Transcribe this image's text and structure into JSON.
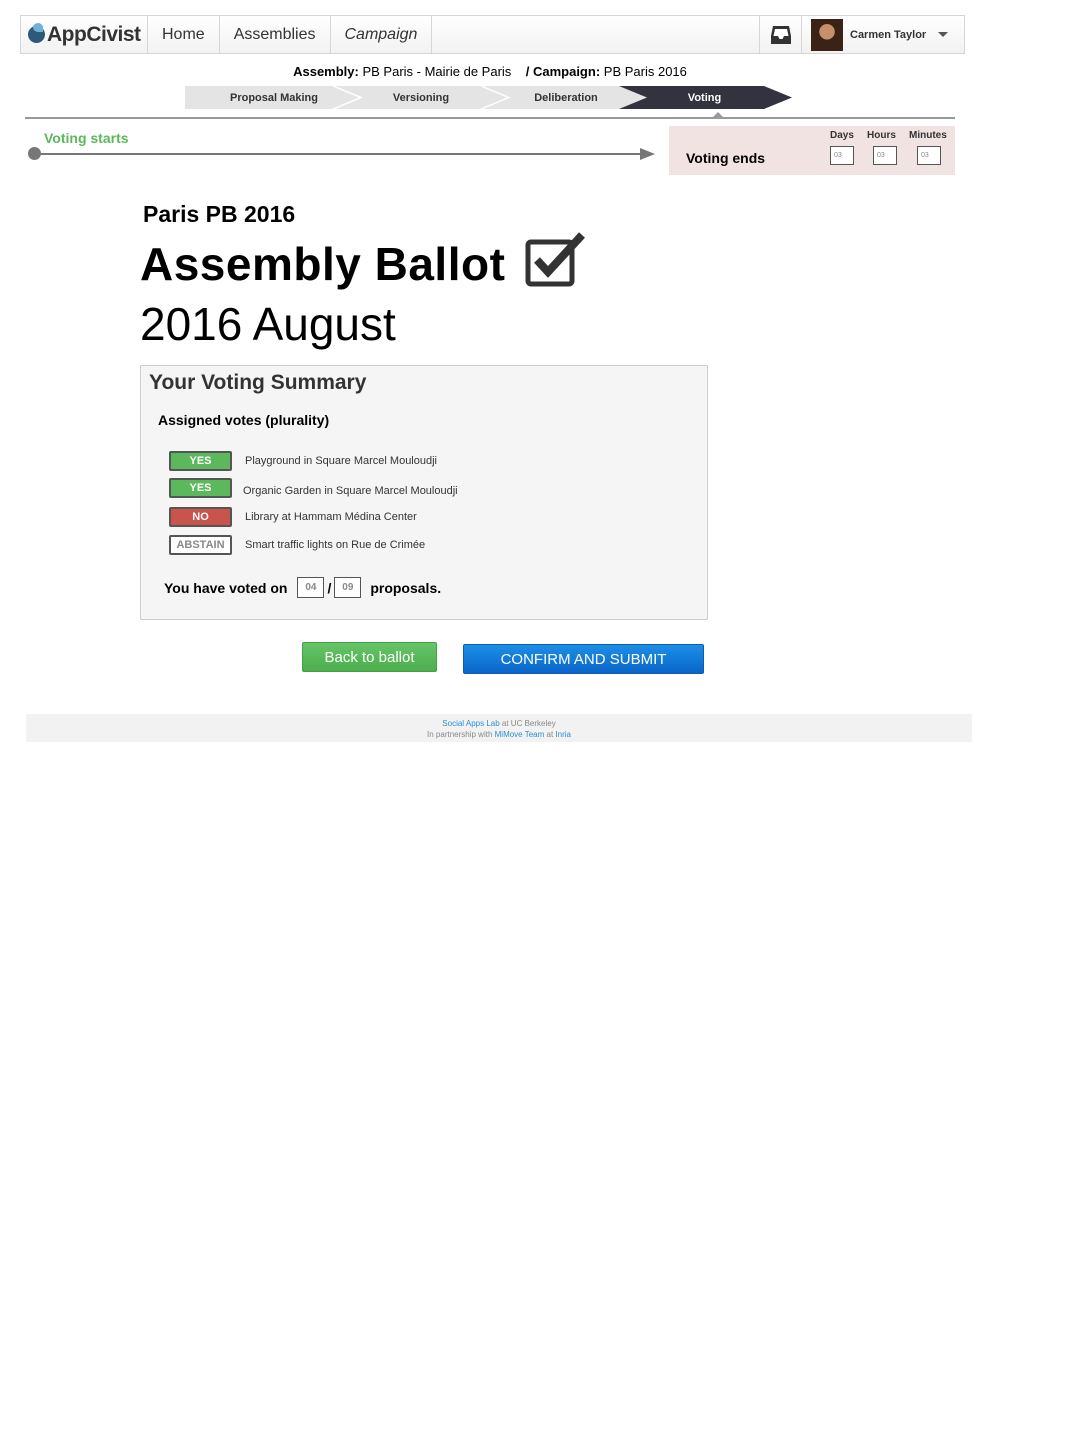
{
  "nav": {
    "logo": "AppCivist",
    "items": [
      {
        "label": "Home"
      },
      {
        "label": "Assemblies"
      },
      {
        "label": "Campaign"
      }
    ],
    "user_name": "Carmen Taylor"
  },
  "breadcrumb": {
    "assembly_label": "Assembly:",
    "assembly_value": "PB Paris - Mairie de Paris",
    "campaign_label": "/ Campaign:",
    "campaign_value": "PB Paris 2016"
  },
  "stages": [
    {
      "label": "Proposal Making",
      "active": false
    },
    {
      "label": "Versioning",
      "active": false
    },
    {
      "label": "Deliberation",
      "active": false
    },
    {
      "label": "Voting",
      "active": true
    }
  ],
  "timeline": {
    "start_label": "Voting starts",
    "end_label": "Voting ends",
    "countdown": {
      "days_label": "Days",
      "days": "03",
      "hours_label": "Hours",
      "hours": "03",
      "minutes_label": "Minutes",
      "minutes": "03"
    }
  },
  "ballot": {
    "subtitle": "Paris PB 2016",
    "title": "Assembly Ballot",
    "date": "2016 August"
  },
  "summary": {
    "title": "Your Voting Summary",
    "subtitle": "Assigned votes (plurality)",
    "votes": [
      {
        "vote": "YES",
        "type": "yes",
        "proposal": "Playground in Square Marcel Mouloudji"
      },
      {
        "vote": "YES",
        "type": "yes",
        "proposal": "Organic Garden in Square Marcel Mouloudji"
      },
      {
        "vote": "NO",
        "type": "no",
        "proposal": "Library at Hammam Médina Center"
      },
      {
        "vote": "ABSTAIN",
        "type": "abstain",
        "proposal": "Smart traffic lights on Rue de Crimée"
      }
    ],
    "count_prefix": "You have voted on",
    "voted": "04",
    "total": "09",
    "count_suffix": "proposals."
  },
  "actions": {
    "back": "Back to ballot",
    "confirm": "CONFIRM AND SUBMIT"
  },
  "footer": {
    "lab_link": "Social Apps Lab",
    "lab_rest": " at UC Berkeley",
    "partner_prefix": "In partnership with ",
    "team_link": "MiMove Team",
    "at": " at ",
    "inst_link": "Inria"
  },
  "colors": {
    "yes": "#5cb85c",
    "no": "#c9544c",
    "confirm": "#0a66c9",
    "active_stage": "#333340",
    "ends_bg": "#f2e3e3"
  }
}
